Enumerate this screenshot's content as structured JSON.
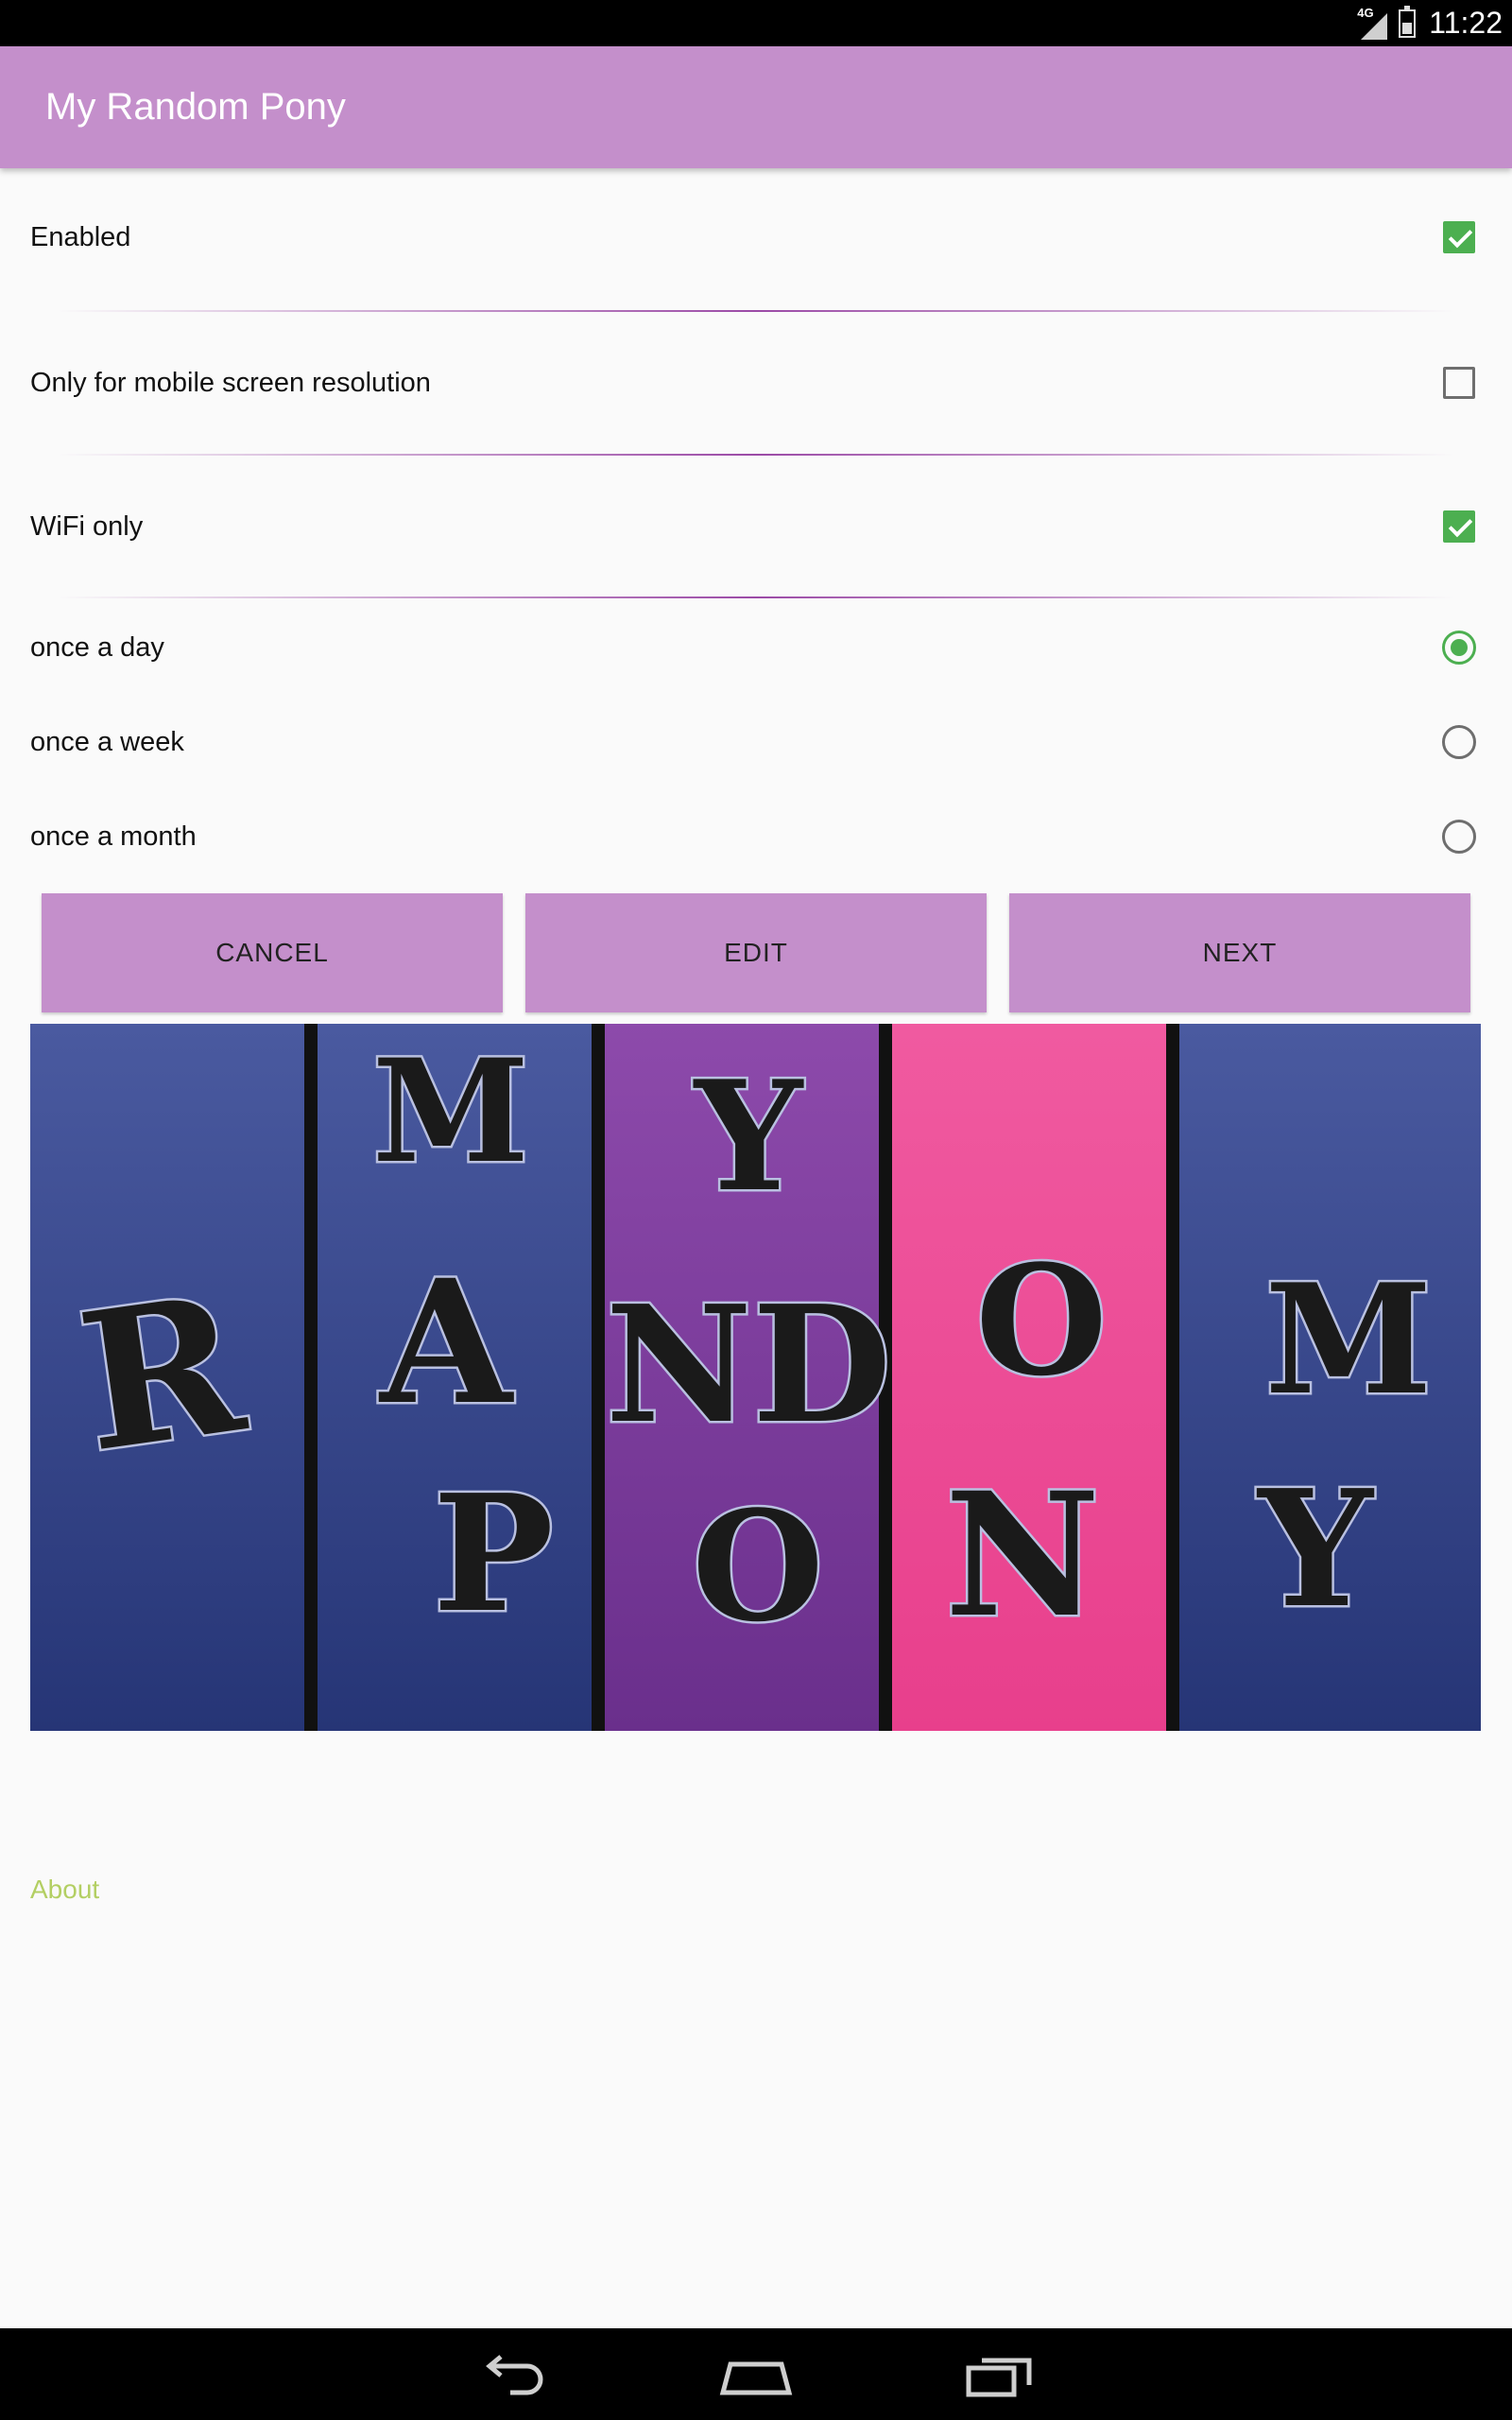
{
  "status_bar": {
    "network": "4G",
    "time": "11:22"
  },
  "app_bar": {
    "title": "My Random Pony"
  },
  "preferences": {
    "enabled": {
      "label": "Enabled",
      "checked": true
    },
    "mobile_only": {
      "label": "Only for mobile screen resolution",
      "checked": false
    },
    "wifi_only": {
      "label": "WiFi only",
      "checked": true
    }
  },
  "frequency": {
    "options": [
      {
        "label": "once a day",
        "selected": true
      },
      {
        "label": "once a week",
        "selected": false
      },
      {
        "label": "once a month",
        "selected": false
      }
    ]
  },
  "buttons": {
    "cancel": "CANCEL",
    "edit": "EDIT",
    "next": "NEXT"
  },
  "banner": {
    "letters": [
      "R",
      "M",
      "A",
      "P",
      "Y",
      "N",
      "D",
      "O",
      "O",
      "N",
      "M",
      "Y"
    ]
  },
  "about_link": "About",
  "colors": {
    "accent": "#c48fcb",
    "check": "#4caf50",
    "link": "#b3cf63",
    "banner_blue": "#2f3f85",
    "banner_purple": "#7a3a99",
    "banner_pink": "#ec4a96"
  },
  "nav_bar": {
    "icons": [
      "back-icon",
      "home-icon",
      "recents-icon"
    ]
  }
}
